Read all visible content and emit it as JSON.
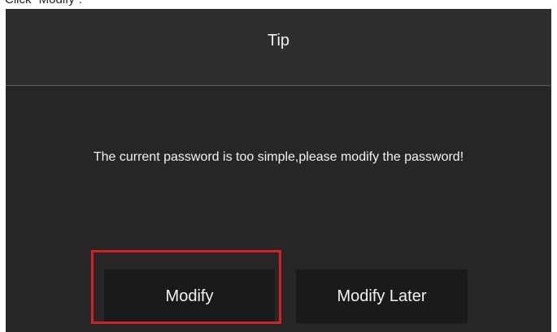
{
  "caption": "Click “Modify”.",
  "dialog": {
    "title": "Tip",
    "message": "The current password is too simple,please modify the password!",
    "buttons": {
      "modify_label": "Modify",
      "modify_later_label": "Modify Later"
    }
  },
  "colors": {
    "dialog_background": "#262626",
    "title_bar_background": "#2e2e2e",
    "button_background": "#1a1a1a",
    "highlight_border": "#d81f24",
    "text": "#f2f2f2"
  }
}
